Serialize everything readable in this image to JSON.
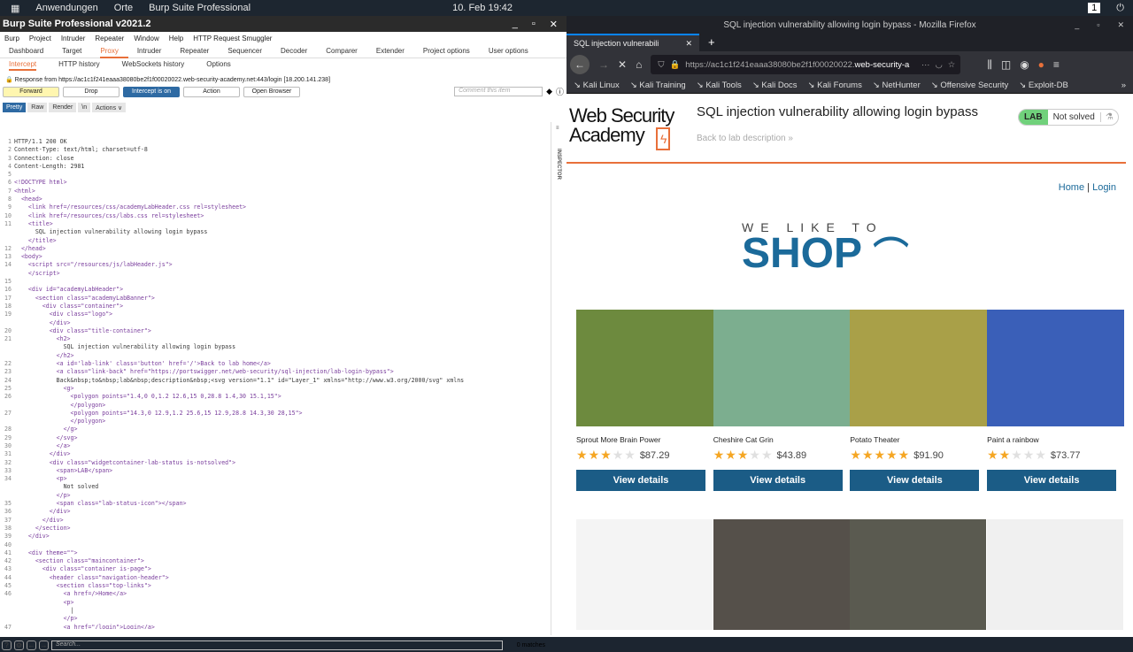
{
  "system": {
    "apps": "Anwendungen",
    "places": "Orte",
    "task": "Burp Suite Professional",
    "clock": "10. Feb 19:42",
    "workspace": "1"
  },
  "burp": {
    "title": "Burp Suite Professional v2021.2",
    "menu": [
      "Burp",
      "Project",
      "Intruder",
      "Repeater",
      "Window",
      "Help",
      "HTTP Request Smuggler"
    ],
    "tabs": [
      "Dashboard",
      "Target",
      "Proxy",
      "Intruder",
      "Repeater",
      "Sequencer",
      "Decoder",
      "Comparer",
      "Extender",
      "Project options",
      "User options"
    ],
    "subtabs": [
      "Intercept",
      "HTTP history",
      "WebSockets history",
      "Options"
    ],
    "response_info": "Response from https://ac1c1f241eaaa38080be2f1f00020022.web-security-academy.net:443/login [18.200.141.238]",
    "buttons": {
      "forward": "Forward",
      "drop": "Drop",
      "intercept": "Intercept is on",
      "action": "Action",
      "open_browser": "Open Browser"
    },
    "comment_placeholder": "Comment this item",
    "view_tabs": [
      "Pretty",
      "Raw",
      "Render",
      "\\n"
    ],
    "actions": "Actions ∨",
    "inspector": "INSPECTOR",
    "search_placeholder": "Search...",
    "matches": "0 matches",
    "code": [
      {
        "n": "1",
        "t": "HTTP/1.1 200 OK"
      },
      {
        "n": "2",
        "t": "Content-Type: text/html; charset=utf-8"
      },
      {
        "n": "3",
        "t": "Connection: close"
      },
      {
        "n": "4",
        "t": "Content-Length: 2981"
      },
      {
        "n": "5",
        "t": ""
      },
      {
        "n": "6",
        "t": "<!DOCTYPE html>"
      },
      {
        "n": "7",
        "t": "<html>"
      },
      {
        "n": "8",
        "t": "  <head>"
      },
      {
        "n": "9",
        "t": "    <link href=/resources/css/academyLabHeader.css rel=stylesheet>"
      },
      {
        "n": "10",
        "t": "    <link href=/resources/css/labs.css rel=stylesheet>"
      },
      {
        "n": "11",
        "t": "    <title>"
      },
      {
        "n": "",
        "t": "      SQL injection vulnerability allowing login bypass"
      },
      {
        "n": "",
        "t": "    </title>"
      },
      {
        "n": "12",
        "t": "  </head>"
      },
      {
        "n": "13",
        "t": "  <body>"
      },
      {
        "n": "14",
        "t": "    <script src=\"/resources/js/labHeader.js\">"
      },
      {
        "n": "",
        "t": "    </script>"
      },
      {
        "n": "15",
        "t": ""
      },
      {
        "n": "16",
        "t": "    <div id=\"academyLabHeader\">"
      },
      {
        "n": "17",
        "t": "      <section class=\"academyLabBanner\">"
      },
      {
        "n": "18",
        "t": "        <div class=\"container\">"
      },
      {
        "n": "19",
        "t": "          <div class=\"logo\">"
      },
      {
        "n": "",
        "t": "          </div>"
      },
      {
        "n": "20",
        "t": "          <div class=\"title-container\">"
      },
      {
        "n": "21",
        "t": "            <h2>"
      },
      {
        "n": "",
        "t": "              SQL injection vulnerability allowing login bypass"
      },
      {
        "n": "",
        "t": "            </h2>"
      },
      {
        "n": "22",
        "t": "            <a id='lab-link' class='button' href='/'>Back to lab home</a>"
      },
      {
        "n": "23",
        "t": "            <a class=\"link-back\" href=\"https://portswigger.net/web-security/sql-injection/lab-login-bypass\">"
      },
      {
        "n": "24",
        "t": "            Back&nbsp;to&nbsp;lab&nbsp;description&nbsp;<svg version=\"1.1\" id=\"Layer_1\" xmlns=\"http://www.w3.org/2000/svg\" xmlns"
      },
      {
        "n": "25",
        "t": "              <g>"
      },
      {
        "n": "26",
        "t": "                <polygon points=\"1.4,0 0,1.2 12.6,15 0,28.8 1.4,30 15.1,15\">"
      },
      {
        "n": "",
        "t": "                </polygon>"
      },
      {
        "n": "27",
        "t": "                <polygon points=\"14.3,0 12.9,1.2 25.6,15 12.9,28.8 14.3,30 28,15\">"
      },
      {
        "n": "",
        "t": "                </polygon>"
      },
      {
        "n": "28",
        "t": "              </g>"
      },
      {
        "n": "29",
        "t": "            </svg>"
      },
      {
        "n": "30",
        "t": "            </a>"
      },
      {
        "n": "31",
        "t": "          </div>"
      },
      {
        "n": "32",
        "t": "          <div class=\"widgetcontainer-lab-status is-notsolved\">"
      },
      {
        "n": "33",
        "t": "            <span>LAB</span>"
      },
      {
        "n": "34",
        "t": "            <p>"
      },
      {
        "n": "",
        "t": "              Not solved"
      },
      {
        "n": "",
        "t": "            </p>"
      },
      {
        "n": "35",
        "t": "            <span class=\"lab-status-icon\"></span>"
      },
      {
        "n": "36",
        "t": "          </div>"
      },
      {
        "n": "37",
        "t": "        </div>"
      },
      {
        "n": "38",
        "t": "      </section>"
      },
      {
        "n": "39",
        "t": "    </div>"
      },
      {
        "n": "40",
        "t": ""
      },
      {
        "n": "41",
        "t": "    <div theme=\"\">"
      },
      {
        "n": "42",
        "t": "      <section class=\"maincontainer\">"
      },
      {
        "n": "43",
        "t": "        <div class=\"container is-page\">"
      },
      {
        "n": "44",
        "t": "          <header class=\"navigation-header\">"
      },
      {
        "n": "45",
        "t": "            <section class=\"top-links\">"
      },
      {
        "n": "46",
        "t": "              <a href=/>Home</a>"
      },
      {
        "n": "",
        "t": "              <p>"
      },
      {
        "n": "",
        "t": "                |"
      },
      {
        "n": "",
        "t": "              </p>"
      },
      {
        "n": "47",
        "t": "              <a href=\"/login\">Login</a>"
      }
    ]
  },
  "firefox": {
    "window_title": "SQL injection vulnerability allowing login bypass - Mozilla Firefox",
    "tab_title": "SQL injection vulnerabili",
    "url_prefix": "https://ac1c1f241eaaa38080be2f1f00020022.",
    "url_domain": "web-security-a",
    "bookmarks": [
      "Kali Linux",
      "Kali Training",
      "Kali Tools",
      "Kali Docs",
      "Kali Forums",
      "NetHunter",
      "Offensive Security",
      "Exploit-DB"
    ],
    "page": {
      "logo_line1": "Web Security",
      "logo_line2": "Academy",
      "lab_title": "SQL injection vulnerability allowing login bypass",
      "back_link": "Back to lab description »",
      "lab_label": "LAB",
      "lab_status": "Not solved",
      "home": "Home",
      "sep": "|",
      "login": "Login",
      "shop_tag": "WE LIKE TO",
      "shop_name": "SHOP",
      "products": [
        {
          "name": "Sprout More Brain Power",
          "rating": 3,
          "price": "$87.29",
          "button": "View details",
          "color": "#6d8a3e"
        },
        {
          "name": "Cheshire Cat Grin",
          "rating": 3,
          "price": "$43.89",
          "button": "View details",
          "color": "#7cae8f"
        },
        {
          "name": "Potato Theater",
          "rating": 5,
          "price": "$91.90",
          "button": "View details",
          "color": "#a9a048"
        },
        {
          "name": "Paint a rainbow",
          "rating": 2,
          "price": "$73.77",
          "button": "View details",
          "color": "#3a5fb8"
        }
      ],
      "row2_colors": [
        "#f4f4f4",
        "#55504a",
        "#5a5a50",
        "#f0f0f0"
      ]
    }
  }
}
